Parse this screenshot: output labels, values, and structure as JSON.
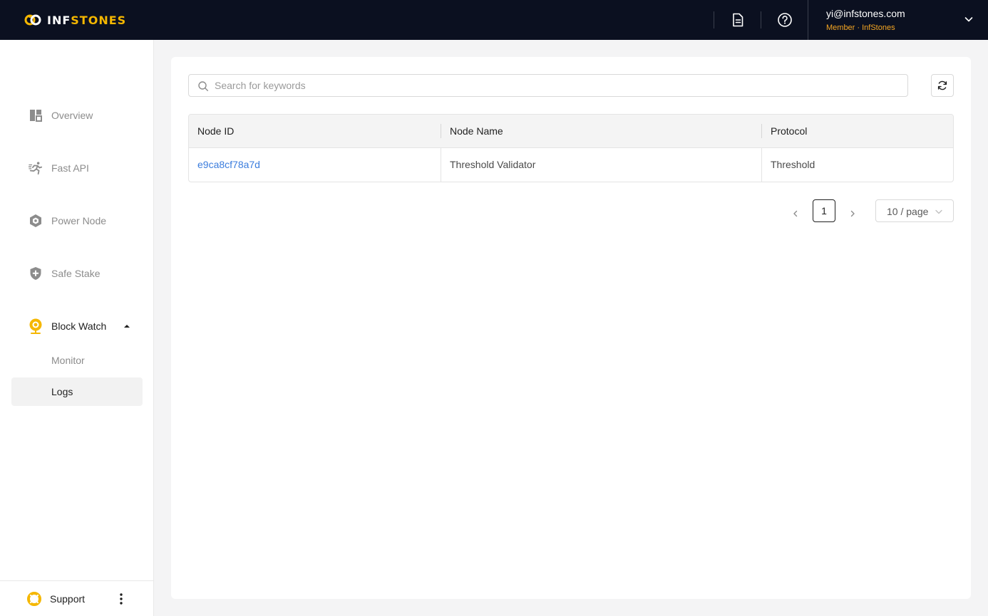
{
  "brand": {
    "name_part1": "INF",
    "name_part2": "STONES",
    "accent_color": "#f5b700"
  },
  "header": {
    "icons": [
      "document-icon",
      "help-circle-icon"
    ],
    "user": {
      "email": "yi@infstones.com",
      "role": "Member · InfStones"
    }
  },
  "sidebar": {
    "items": [
      {
        "label": "Overview",
        "icon": "dashboard-icon"
      },
      {
        "label": "Fast API",
        "icon": "running-icon"
      },
      {
        "label": "Power Node",
        "icon": "hexagon-node-icon"
      },
      {
        "label": "Safe Stake",
        "icon": "shield-plus-icon"
      },
      {
        "label": "Block Watch",
        "icon": "webcam-icon",
        "expanded": true
      }
    ],
    "subitems": [
      {
        "label": "Monitor",
        "active": false
      },
      {
        "label": "Logs",
        "active": true
      }
    ],
    "support": {
      "label": "Support",
      "icon": "lifebuoy-icon"
    }
  },
  "search": {
    "placeholder": "Search for keywords",
    "value": ""
  },
  "table": {
    "columns": [
      "Node ID",
      "Node Name",
      "Protocol"
    ],
    "rows": [
      {
        "node_id": "e9ca8cf78a7d",
        "node_name": "Threshold Validator",
        "protocol": "Threshold"
      }
    ]
  },
  "pagination": {
    "current_page": "1",
    "page_size": "10 / page"
  }
}
